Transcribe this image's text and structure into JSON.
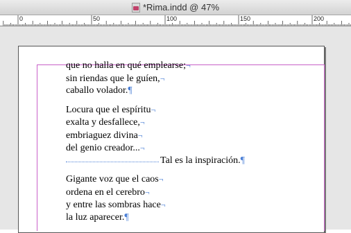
{
  "window": {
    "title": "*Rima.indd @ 47%"
  },
  "ruler": {
    "labels": [
      "0",
      "50",
      "100",
      "150",
      "200"
    ]
  },
  "text": {
    "stanza1": [
      "que no halla en qué emplearse;",
      "sin riendas que le guíen,",
      "caballo volador."
    ],
    "stanza2": [
      "Locura que el espíritu",
      "exalta y desfallece,",
      "embriaguez divina",
      "del genio creador..."
    ],
    "tab_line": "Tal es la inspiración.",
    "stanza3": [
      "Gigante voz que el caos",
      "ordena en el cerebro",
      "y entre las sombras hace",
      "la luz aparecer."
    ]
  },
  "marks": {
    "line_break": "¬",
    "paragraph": "¶"
  },
  "colors": {
    "margin_guide": "#c85fc8",
    "hidden_chars": "#4a7fd6",
    "pasteboard": "#e6e6e6"
  },
  "icons": {
    "document": "indesign-document-icon"
  }
}
